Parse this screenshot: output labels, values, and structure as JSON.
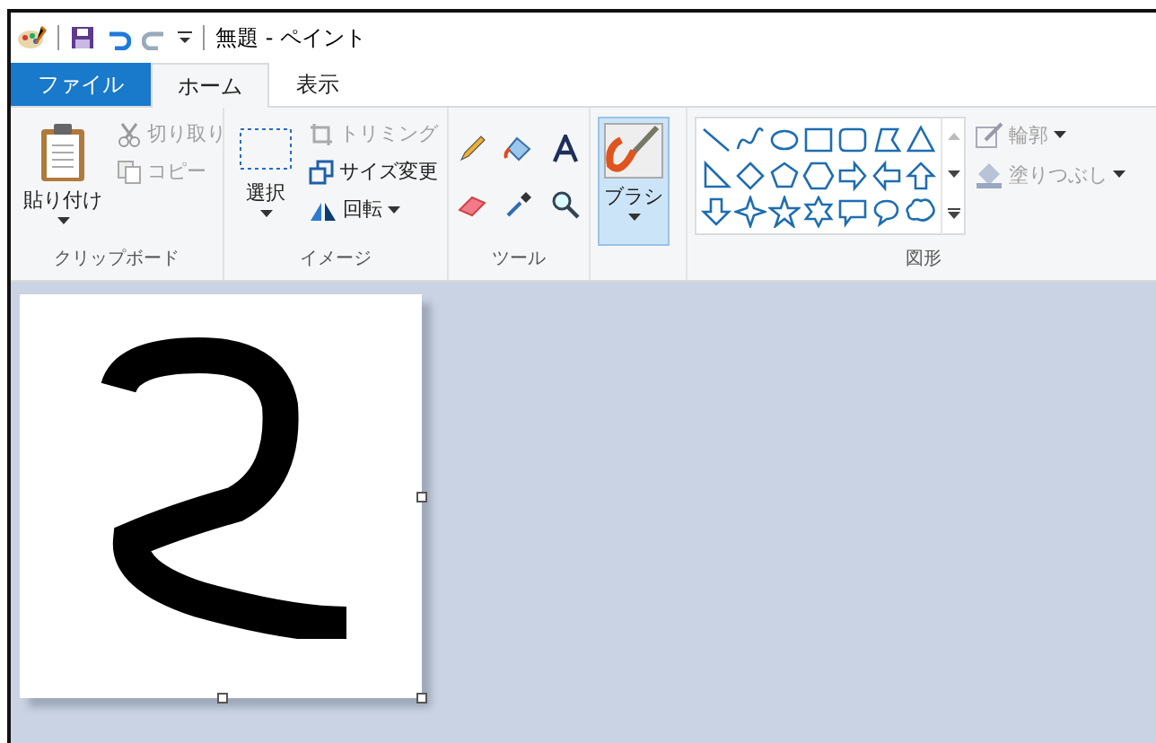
{
  "window": {
    "title": "無題 - ペイント"
  },
  "tabs": [
    {
      "label": "ファイル",
      "kind": "file",
      "selected": false
    },
    {
      "label": "ホーム",
      "kind": "tab",
      "selected": true
    },
    {
      "label": "表示",
      "kind": "tab",
      "selected": false
    }
  ],
  "clipboard": {
    "paste": "貼り付け",
    "items": [
      {
        "label": "切り取り",
        "disabled": true
      },
      {
        "label": "コピー",
        "disabled": true
      }
    ],
    "label": "クリップボード"
  },
  "image": {
    "select": "選択",
    "items": [
      {
        "label": "トリミング",
        "disabled": true
      },
      {
        "label": "サイズ変更",
        "disabled": false
      },
      {
        "label": "回転",
        "disabled": false
      }
    ],
    "label": "イメージ"
  },
  "tools": {
    "label": "ツール"
  },
  "brush": {
    "label": "ブラシ",
    "selected": true
  },
  "shapes": {
    "options": [
      {
        "label": "輪郭",
        "disabled": true
      },
      {
        "label": "塗りつぶし",
        "disabled": true
      }
    ],
    "label": "図形"
  }
}
